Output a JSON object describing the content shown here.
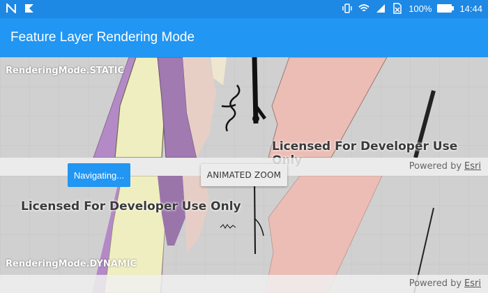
{
  "status_bar": {
    "battery_percent": "100%",
    "time": "14:44",
    "icons": [
      "notification-n-icon",
      "notification-arrow-icon",
      "vibrate-icon",
      "wifi-icon",
      "signal-icon",
      "no-sim-icon",
      "battery-icon"
    ]
  },
  "app_bar": {
    "title": "Feature Layer Rendering Mode"
  },
  "static_map": {
    "label": "RenderingMode.STATIC",
    "license_text": "Licensed For Developer Use Only",
    "powered_by": "Powered by",
    "esri_link": "Esri"
  },
  "dynamic_map": {
    "label": "RenderingMode.DYNAMIC",
    "license_text": "Licensed For Developer Use Only",
    "powered_by": "Powered by",
    "esri_link": "Esri"
  },
  "controls": {
    "navigating_label": "Navigating...",
    "animated_zoom_label": "ANIMATED ZOOM"
  },
  "colors": {
    "status_bar": "#1e88e5",
    "app_bar": "#2196f3",
    "map_background": "#d0d0d0",
    "purple_feature": "#b48ac6",
    "yellow_feature": "#eeeec0",
    "pink_feature": "#ebbdb5"
  }
}
